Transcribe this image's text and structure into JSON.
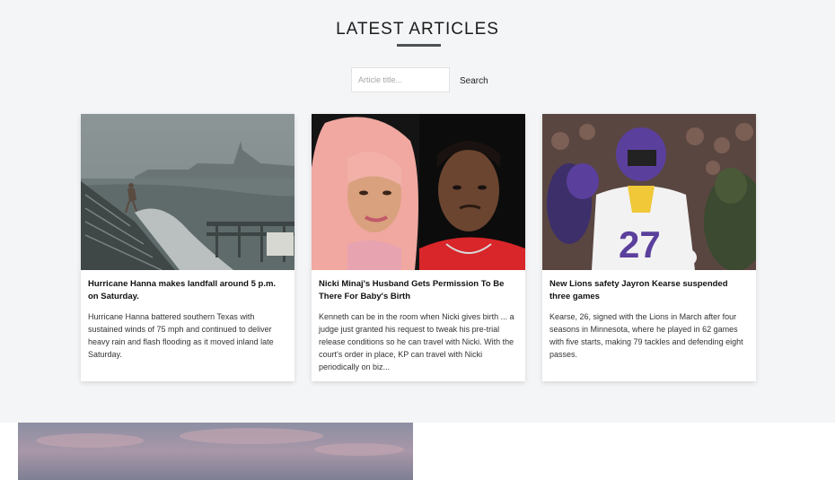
{
  "section": {
    "title": "LATEST ARTICLES"
  },
  "search": {
    "placeholder": "Article title...",
    "button_label": "Search"
  },
  "articles": [
    {
      "title": "Hurricane Hanna makes landfall around 5 p.m. on Saturday.",
      "summary": "Hurricane Hanna battered southern Texas with sustained winds of 75 mph and continued to deliver heavy rain and flash flooding as it moved inland late Saturday.",
      "image": "hurricane-pier-photo"
    },
    {
      "title": "Nicki Minaj's Husband Gets Permission To Be There For Baby's Birth",
      "summary": "Kenneth can be in the room when Nicki gives birth ... a judge just granted his request to tweak his pre-trial release conditions so he can travel with Nicki. With the court's order in place, KP can travel with Nicki periodically on biz...",
      "image": "couple-portrait-photo"
    },
    {
      "title": "New Lions safety Jayron Kearse suspended three games",
      "summary": "Kearse, 26, signed with the Lions in March after four seasons in Minnesota, where he played in 62 games with five starts, making 79 tackles and defending eight passes.",
      "image": "football-player-photo"
    }
  ],
  "bottom_feature": {
    "image": "sky-landscape-photo"
  }
}
